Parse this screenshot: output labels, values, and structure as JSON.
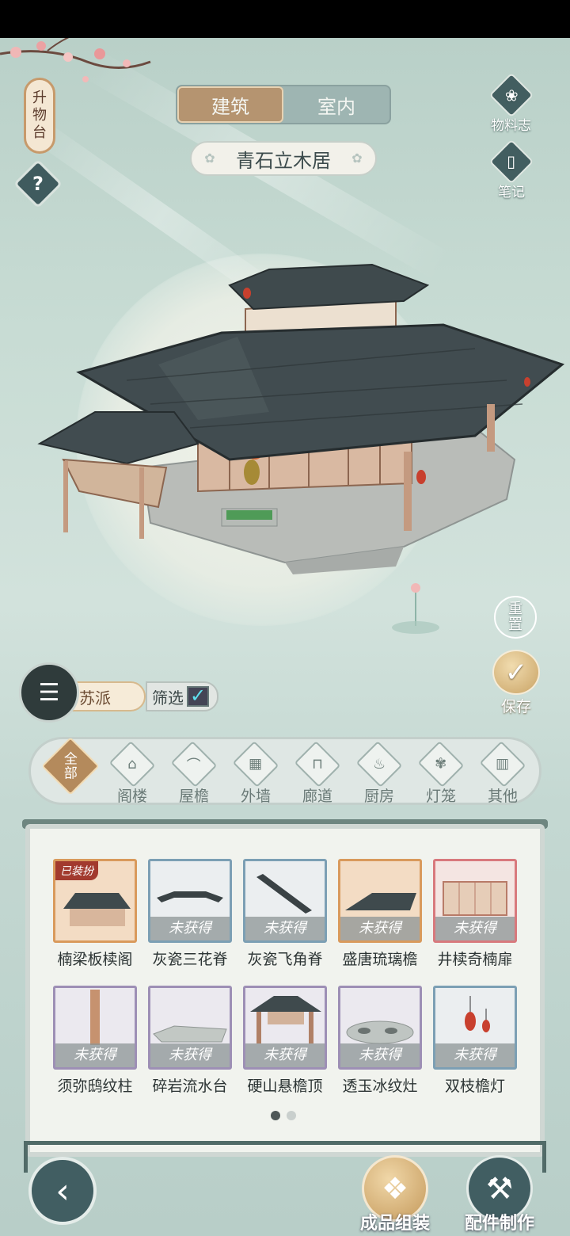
{
  "sign": {
    "chars": [
      "升",
      "物",
      "台"
    ]
  },
  "help": {
    "glyph": "?"
  },
  "tabs": [
    {
      "label": "建筑",
      "active": true
    },
    {
      "label": "室内",
      "active": false
    }
  ],
  "house_name": "青石立木居",
  "right_buttons": {
    "materials": "物料志",
    "notes": "笔记"
  },
  "reset": {
    "line1": "重",
    "line2": "置"
  },
  "save": {
    "label": "保存"
  },
  "style_chip": {
    "label": "苏派"
  },
  "filter": {
    "label": "筛选",
    "checked": true
  },
  "categories": [
    {
      "label_top": "全",
      "label_bottom": "部",
      "active": true
    },
    {
      "label": "阁楼",
      "icon": "pavilion-icon"
    },
    {
      "label": "屋檐",
      "icon": "eave-icon"
    },
    {
      "label": "外墙",
      "icon": "wall-icon"
    },
    {
      "label": "廊道",
      "icon": "corridor-icon"
    },
    {
      "label": "厨房",
      "icon": "kitchen-icon"
    },
    {
      "label": "灯笼",
      "icon": "lantern-icon"
    },
    {
      "label": "其他",
      "icon": "other-icon"
    }
  ],
  "items": [
    {
      "name": "楠梁板椟阁",
      "status": "",
      "badge": "已装扮",
      "frame": "orange"
    },
    {
      "name": "灰瓷三花脊",
      "status": "未获得",
      "frame": "blue"
    },
    {
      "name": "灰瓷飞角脊",
      "status": "未获得",
      "frame": "blue"
    },
    {
      "name": "盛唐琉璃檐",
      "status": "未获得",
      "frame": "orange"
    },
    {
      "name": "井椟奇楠扉",
      "status": "未获得",
      "frame": "red"
    },
    {
      "name": "须弥鸱纹柱",
      "status": "未获得",
      "frame": "purple"
    },
    {
      "name": "碎岩流水台",
      "status": "未获得",
      "frame": "purple"
    },
    {
      "name": "硬山悬檐顶",
      "status": "未获得",
      "frame": "purple"
    },
    {
      "name": "透玉冰纹灶",
      "status": "未获得",
      "frame": "purple"
    },
    {
      "name": "双枝檐灯",
      "status": "未获得",
      "frame": "blue"
    }
  ],
  "pagination": {
    "current": 1,
    "total": 2
  },
  "bottom": {
    "assemble": "成品组装",
    "craft": "配件制作"
  },
  "colors": {
    "accent": "#b59470",
    "panel": "#f1f3ee",
    "dark": "#415e62"
  }
}
